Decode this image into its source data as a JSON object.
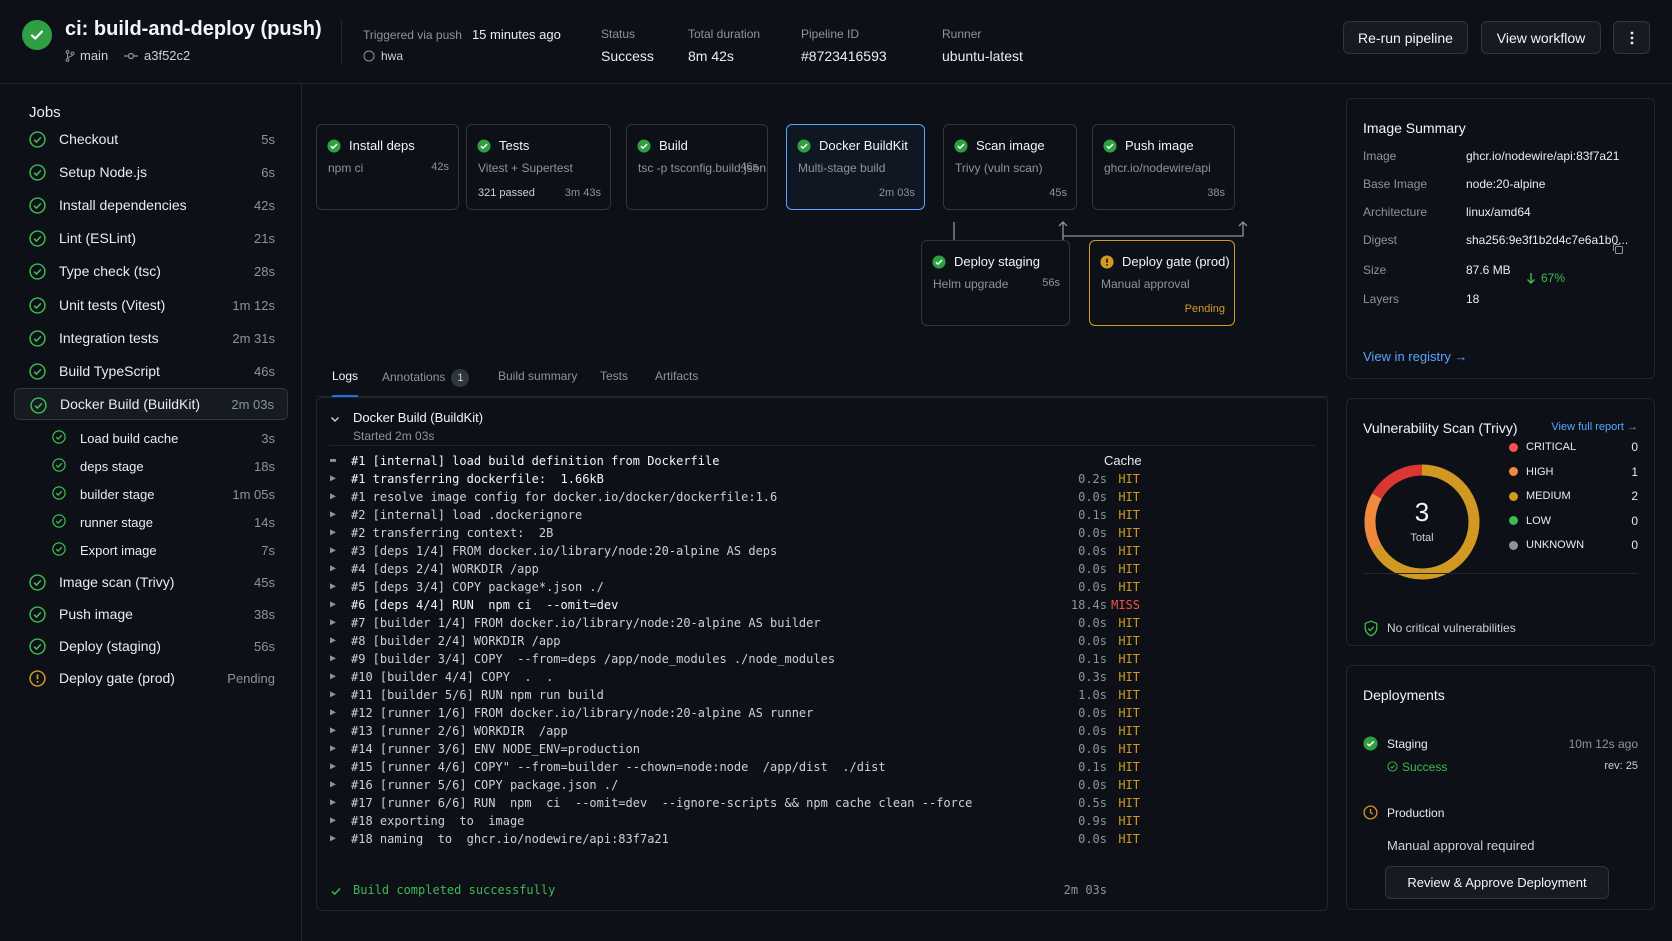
{
  "header": {
    "title": "ci: build-and-deploy (push)",
    "branch": "main",
    "commit": "a3f52c2",
    "trigger_label": "Triggered via push",
    "trigger_time": "15 minutes ago",
    "trigger_user": "hwa",
    "status_label": "Status",
    "status_value": "Success",
    "duration_label": "Total duration",
    "duration_value": "8m 42s",
    "pipeline_label": "Pipeline ID",
    "pipeline_value": "#8723416593",
    "runner_label": "Runner",
    "runner_value": "ubuntu-latest",
    "rerun_label": "Re-run pipeline",
    "workflow_label": "View workflow"
  },
  "sidebar": {
    "title": "Jobs",
    "jobs": [
      {
        "name": "Checkout",
        "duration": "5s",
        "status": "success"
      },
      {
        "name": "Setup Node.js",
        "duration": "6s",
        "status": "success"
      },
      {
        "name": "Install dependencies",
        "duration": "42s",
        "status": "success"
      },
      {
        "name": "Lint (ESLint)",
        "duration": "21s",
        "status": "success"
      },
      {
        "name": "Type check (tsc)",
        "duration": "28s",
        "status": "success"
      },
      {
        "name": "Unit tests (Vitest)",
        "duration": "1m 12s",
        "status": "success"
      },
      {
        "name": "Integration tests",
        "duration": "2m 31s",
        "status": "success"
      },
      {
        "name": "Build TypeScript",
        "duration": "46s",
        "status": "success"
      },
      {
        "name": "Docker Build (BuildKit)",
        "duration": "2m 03s",
        "status": "success"
      },
      {
        "name": "Load build cache",
        "duration": "3s",
        "status": "success"
      },
      {
        "name": "deps stage",
        "duration": "18s",
        "status": "success"
      },
      {
        "name": "builder stage",
        "duration": "1m 05s",
        "status": "success"
      },
      {
        "name": "runner stage",
        "duration": "14s",
        "status": "success"
      },
      {
        "name": "Export image",
        "duration": "7s",
        "status": "success"
      },
      {
        "name": "Image scan (Trivy)",
        "duration": "45s",
        "status": "success"
      },
      {
        "name": "Push image",
        "duration": "38s",
        "status": "success"
      },
      {
        "name": "Deploy (staging)",
        "duration": "56s",
        "status": "success"
      },
      {
        "name": "Deploy gate (prod)",
        "duration": "Pending",
        "status": "pending"
      }
    ]
  },
  "pipeline": {
    "nodes": [
      {
        "title": "Install deps",
        "sub": "npm ci",
        "duration": "42s"
      },
      {
        "title": "Tests",
        "sub": "Vitest + Supertest",
        "extra": "321 passed",
        "duration": "3m 43s"
      },
      {
        "title": "Build",
        "sub": "tsc -p tsconfig.build.json",
        "duration": "46s"
      },
      {
        "title": "Docker BuildKit",
        "sub": "Multi-stage build",
        "duration": "2m 03s"
      },
      {
        "title": "Scan image",
        "sub": "Trivy (vuln scan)",
        "duration": "45s"
      },
      {
        "title": "Push image",
        "sub": "ghcr.io/nodewire/api",
        "duration": "38s"
      },
      {
        "title": "Deploy staging",
        "sub": "Helm upgrade",
        "duration": "56s"
      },
      {
        "title": "Deploy gate (prod)",
        "sub": "Manual approval",
        "duration": "Pending"
      }
    ]
  },
  "tabs": [
    {
      "label": "Logs"
    },
    {
      "label": "Annotations",
      "badge": "1"
    },
    {
      "label": "Build summary"
    },
    {
      "label": "Tests"
    },
    {
      "label": "Artifacts"
    }
  ],
  "log": {
    "title": "Docker Build (BuildKit)",
    "started": "Started 2m 03s",
    "cache_header": "Cache",
    "lines": [
      {
        "text": "#1 [internal] load build definition from Dockerfile",
        "time": "",
        "cache": "",
        "expanded": true
      },
      {
        "text": "#1 transferring dockerfile:  1.66kB",
        "time": "0.2s",
        "cache": "HIT"
      },
      {
        "text": "#1 resolve image config for docker.io/docker/dockerfile:1.6",
        "time": "0.0s",
        "cache": "HIT"
      },
      {
        "text": "#2 [internal] load .dockerignore",
        "time": "0.1s",
        "cache": "HIT"
      },
      {
        "text": "#2 transferring context:  2B",
        "time": "0.0s",
        "cache": "HIT"
      },
      {
        "text": "#3 [deps 1/4] FROM docker.io/library/node:20-alpine AS deps",
        "time": "0.0s",
        "cache": "HIT"
      },
      {
        "text": "#4 [deps 2/4] WORKDIR /app",
        "time": "0.0s",
        "cache": "HIT"
      },
      {
        "text": "#5 [deps 3/4] COPY package*.json ./",
        "time": "0.0s",
        "cache": "HIT"
      },
      {
        "text": "#6 [deps 4/4] RUN  npm ci  --omit=dev",
        "time": "18.4s",
        "cache": "MISS"
      },
      {
        "text": "#7 [builder 1/4] FROM docker.io/library/node:20-alpine AS builder",
        "time": "0.0s",
        "cache": "HIT"
      },
      {
        "text": "#8 [builder 2/4] WORKDIR /app",
        "time": "0.0s",
        "cache": "HIT"
      },
      {
        "text": "#9 [builder 3/4] COPY  --from=deps /app/node_modules ./node_modules",
        "time": "0.1s",
        "cache": "HIT"
      },
      {
        "text": "#10 [builder 4/4] COPY  .  .",
        "time": "0.3s",
        "cache": "HIT"
      },
      {
        "text": "#11 [builder 5/6] RUN npm run build",
        "time": "1.0s",
        "cache": "HIT"
      },
      {
        "text": "#12 [runner 1/6] FROM docker.io/library/node:20-alpine AS runner",
        "time": "0.0s",
        "cache": "HIT"
      },
      {
        "text": "#13 [runner 2/6] WORKDIR  /app",
        "time": "0.0s",
        "cache": "HIT"
      },
      {
        "text": "#14 [runner 3/6] ENV NODE_ENV=production",
        "time": "0.0s",
        "cache": "HIT"
      },
      {
        "text": "#15 [runner 4/6] COPY\" --from=builder --chown=node:node  /app/dist  ./dist",
        "time": "0.1s",
        "cache": "HIT"
      },
      {
        "text": "#16 [runner 5/6] COPY package.json ./",
        "time": "0.0s",
        "cache": "HIT"
      },
      {
        "text": "#17 [runner 6/6] RUN  npm  ci  --omit=dev  --ignore-scripts && npm cache clean --force",
        "time": "0.5s",
        "cache": "HIT"
      },
      {
        "text": "#18 exporting  to  image",
        "time": "0.9s",
        "cache": "HIT"
      },
      {
        "text": "#18 naming  to  ghcr.io/nodewire/api:83f7a21",
        "time": "0.0s",
        "cache": "HIT"
      }
    ],
    "done": "Build completed successfully",
    "done_duration": "2m 03s"
  },
  "image_summary": {
    "title": "Image Summary",
    "rows": [
      {
        "label": "Image",
        "value": "ghcr.io/nodewire/api:83f7a21"
      },
      {
        "label": "Base Image",
        "value": "node:20-alpine"
      },
      {
        "label": "Architecture",
        "value": "linux/amd64"
      },
      {
        "label": "Digest",
        "value": "sha256:9e3f1b2d4c7e6a1b0..."
      },
      {
        "label": "Size",
        "value": "87.6 MB"
      },
      {
        "label": "Layers",
        "value": "18"
      }
    ],
    "size_delta": "67%",
    "registry_link": "View in registry →"
  },
  "vuln": {
    "title": "Vulnerability Scan (Trivy)",
    "report_link": "View full report →",
    "total": "3",
    "total_label": "Total",
    "items": [
      {
        "label": "CRITICAL",
        "count": 0,
        "color": "#f85149"
      },
      {
        "label": "HIGH",
        "count": 1,
        "color": "#f0883e"
      },
      {
        "label": "MEDIUM",
        "count": 2,
        "color": "#d29922"
      },
      {
        "label": "LOW",
        "count": 0,
        "color": "#3fb950"
      },
      {
        "label": "UNKNOWN",
        "count": 0,
        "color": "#8b949e"
      }
    ],
    "note": "No critical vulnerabilities"
  },
  "deployments": {
    "title": "Deployments",
    "staging_name": "Staging",
    "staging_time": "10m 12s ago",
    "staging_status": "Success",
    "staging_rev": "rev: 25",
    "prod_name": "Production",
    "prod_status": "Manual approval required",
    "approve_label": "Review & Approve Deployment"
  },
  "colors": {
    "success": "#3fb950",
    "pending": "#d29922",
    "accent": "#58a6ff"
  }
}
